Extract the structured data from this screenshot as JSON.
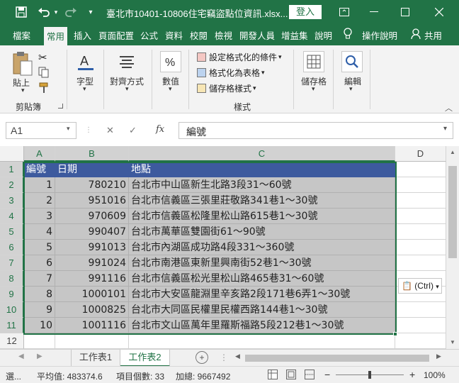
{
  "title": {
    "filename": "臺北市10401-10806住宅竊盜點位資訊.xlsx...",
    "login_label": "登入",
    "save_icon": "save-icon",
    "undo_icon": "undo-icon",
    "redo_icon": "redo-icon"
  },
  "tabs": [
    "檔案",
    "常用",
    "插入",
    "頁面配置",
    "公式",
    "資料",
    "校閱",
    "檢視",
    "開發人員",
    "增益集",
    "說明"
  ],
  "active_tab": "常用",
  "tell_me": "操作說明",
  "share": "共用",
  "ribbon": {
    "paste": "貼上",
    "clipboard": "剪貼簿",
    "font": "字型",
    "align": "對齊方式",
    "number": "數值",
    "cond_format": "設定格式化的條件",
    "format_table": "格式化為表格",
    "cell_styles": "儲存格樣式",
    "styles_group": "樣式",
    "cells": "儲存格",
    "editing": "編輯"
  },
  "name_box": "A1",
  "formula_value": "編號",
  "columns": [
    "A",
    "B",
    "C",
    "D"
  ],
  "rows": [
    "1",
    "2",
    "3",
    "4",
    "5",
    "6",
    "7",
    "8",
    "9",
    "10",
    "11",
    "12"
  ],
  "header_row": {
    "a": "編號",
    "b": "日期",
    "c": "地點"
  },
  "table_rows": [
    {
      "a": "1",
      "b": "780210",
      "c": "台北市中山區新生北路3段31～60號"
    },
    {
      "a": "2",
      "b": "951016",
      "c": "台北市信義區三張里莊敬路341巷1～30號"
    },
    {
      "a": "3",
      "b": "970609",
      "c": "台北市信義區松隆里松山路615巷1～30號"
    },
    {
      "a": "4",
      "b": "990407",
      "c": "台北市萬華區雙園街61～90號"
    },
    {
      "a": "5",
      "b": "991013",
      "c": "台北市內湖區成功路4段331～360號"
    },
    {
      "a": "6",
      "b": "991024",
      "c": "台北市南港區東新里興南街52巷1～30號"
    },
    {
      "a": "7",
      "b": "991116",
      "c": "台北市信義區松光里松山路465巷31～60號"
    },
    {
      "a": "8",
      "b": "1000101",
      "c": "台北市大安區龍淵里辛亥路2段171巷6弄1～30號"
    },
    {
      "a": "9",
      "b": "1000825",
      "c": "台北市大同區民權里民權西路144巷1～30號"
    },
    {
      "a": "10",
      "b": "1001116",
      "c": "台北市文山區萬年里羅斯福路5段212巷1～30號"
    }
  ],
  "paste_options": "(Ctrl)",
  "sheets": [
    "工作表1",
    "工作表2"
  ],
  "active_sheet": "工作表2",
  "status": {
    "mode": "選...",
    "average": "平均值: 483374.6",
    "count": "項目個數: 33",
    "sum": "加總: 9667492",
    "zoom": "100%"
  },
  "colors": {
    "accent": "#217346",
    "table_header": "#3d5a9e",
    "selection_fill": "#c6c6c6"
  }
}
